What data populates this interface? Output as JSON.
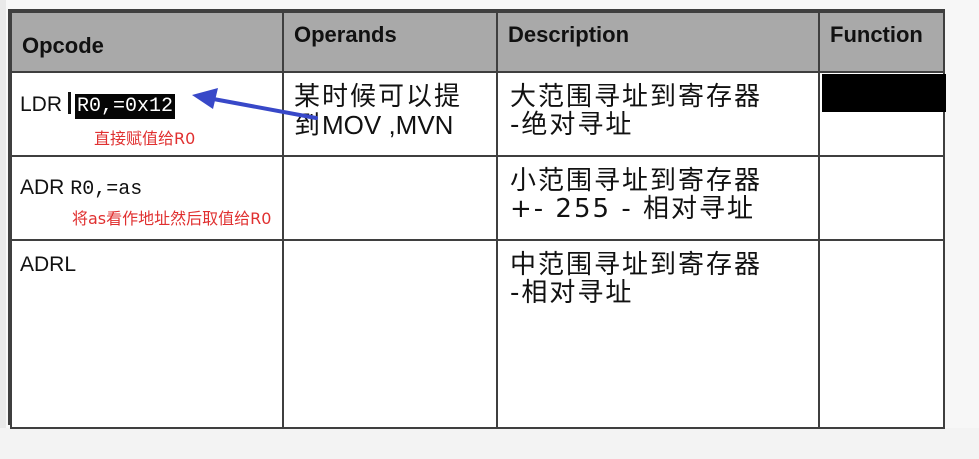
{
  "table": {
    "headers": [
      "Opcode",
      "Operands",
      "Description",
      "Function"
    ],
    "rows": [
      {
        "opcode": "LDR",
        "opcode_code": "R0,=0x12",
        "annotation": "直接赋值给R0",
        "operands_line1": "某时候可以提",
        "operands_line2_cjk": "到",
        "operands_line2_latin": "MOV ,MVN",
        "description_line1": "大范围寻址到寄存器",
        "description_line2": "-绝对寻址"
      },
      {
        "opcode": "ADR",
        "opcode_code": "R0,=as",
        "annotation": "将as看作地址然后取值给R0",
        "description_line1": "小范围寻址到寄存器",
        "description_line2": "+- 255 - 相对寻址"
      },
      {
        "opcode": "ADRL",
        "description_line1": "中范围寻址到寄存器",
        "description_line2": "-相对寻址"
      }
    ]
  },
  "colors": {
    "header_bg": "#a9a9a9",
    "border": "#3f3f3f",
    "annotation": "#e03030",
    "arrow": "#3848c8"
  },
  "icons": [
    "arrow-pointer-icon",
    "text-cursor-icon"
  ]
}
